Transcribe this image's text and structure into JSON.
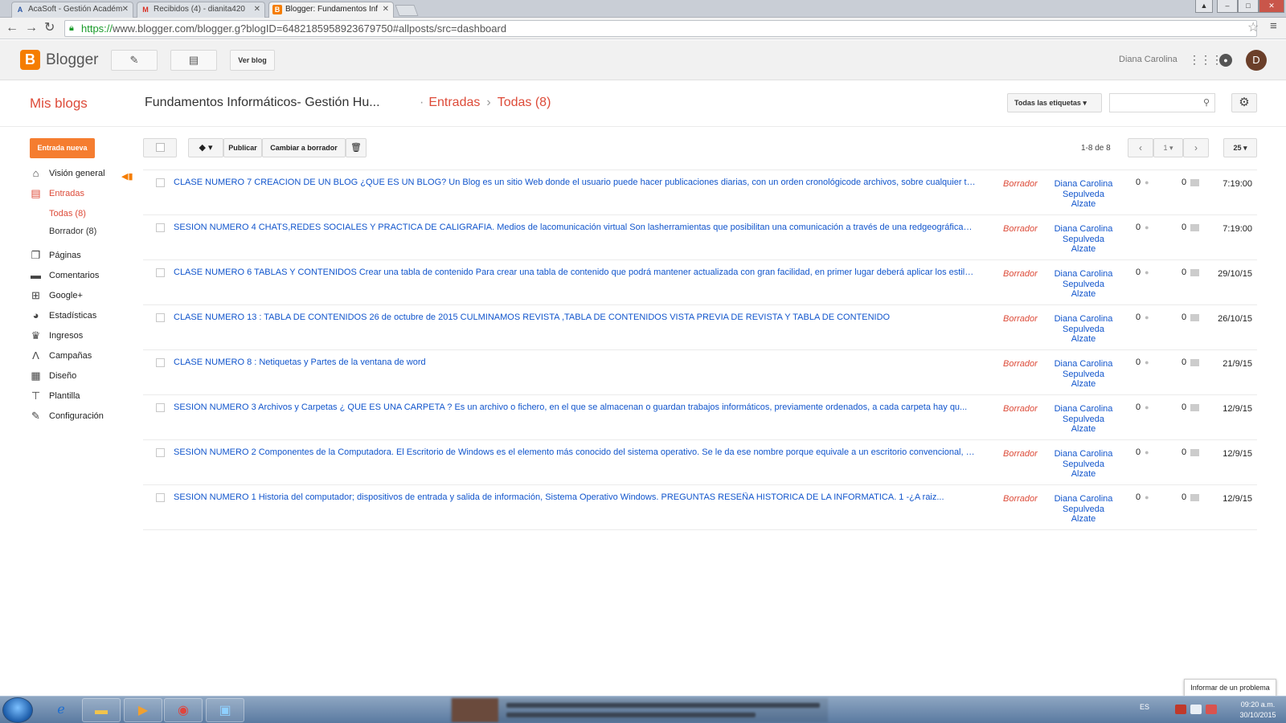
{
  "browser": {
    "tabs": [
      {
        "label": "AcaSoft - Gestión Académ",
        "icon": "acasoft-icon",
        "icon_color": "#2a55a5",
        "active": false
      },
      {
        "label": "Recibidos (4) - dianita420",
        "icon": "gmail-icon",
        "icon_color": "#d93025",
        "active": false
      },
      {
        "label": "Blogger: Fundamentos Inf",
        "icon": "blogger-icon",
        "icon_color": "#f57d00",
        "active": true
      }
    ],
    "url_scheme": "https://",
    "url_rest": "www.blogger.com/blogger.g?blogID=6482185958923679750#allposts/src=dashboard"
  },
  "header": {
    "brand": "Blogger",
    "view_blog_label": "Ver blog",
    "user_name": "Diana Carolina",
    "avatar_letter": "D"
  },
  "titlebar": {
    "my_blogs": "Mis blogs",
    "blog_name": "Fundamentos Informáticos- Gestión Hu...",
    "crumb_section": "Entradas",
    "crumb_filter": "Todas (8)",
    "labels_select": "Todas las etiquetas"
  },
  "sidebar": {
    "new_post_label": "Entrada nueva",
    "overview": "Visión general",
    "posts": "Entradas",
    "posts_all": "Todas (8)",
    "posts_draft": "Borrador (8)",
    "pages": "Páginas",
    "comments": "Comentarios",
    "google_plus": "Google+",
    "stats": "Estadísticas",
    "earnings": "Ingresos",
    "campaigns": "Campañas",
    "layout": "Diseño",
    "template": "Plantilla",
    "settings": "Configuración"
  },
  "toolbar": {
    "publish": "Publicar",
    "revert_draft": "Cambiar a borrador",
    "page_info": "1-8 de 8",
    "page_number": "1",
    "per_page": "25"
  },
  "posts": [
    {
      "title": "CLASE NUMERO 7 CREACION DE UN BLOG ¿QUE ES UN BLOG?   Un Blog es un sitio Web donde el usuario puede hacer publicaciones diarias, con un orden cronológicode archivos, sobre cualquier te...",
      "status": "Borrador",
      "author1": "Diana Carolina",
      "author2": "Sepulveda",
      "author3": "Alzate",
      "comments": "0",
      "views": "0",
      "date": "7:19:00"
    },
    {
      "title": "SESIÓN NUMERO 4 CHATS,REDES SOCIALES Y PRACTICA DE CALIGRAFIA. Medios de lacomunicación virtual Son lasherramientas que posibilitan una comunicación a través de una redgeográficame...",
      "status": "Borrador",
      "author1": "Diana Carolina",
      "author2": "Sepulveda",
      "author3": "Alzate",
      "comments": "0",
      "views": "0",
      "date": "7:19:00"
    },
    {
      "title": "CLASE NUMERO 6 TABLAS Y CONTENIDOS Crear una tabla de contenido Para crear una tabla de contenido que podrá mantener actualizada con gran facilidad, en primer lugar deberá aplicar los estilos d...",
      "status": "Borrador",
      "author1": "Diana Carolina",
      "author2": "Sepulveda",
      "author3": "Alzate",
      "comments": "0",
      "views": "0",
      "date": "29/10/15"
    },
    {
      "title": "CLASE NUMERO 13 :    TABLA DE CONTENIDOS 26 de octubre de 2015 CULMINAMOS REVISTA ,TABLA DE CONTENIDOS VISTA PREVIA DE REVISTA Y TABLA DE CONTENIDO",
      "status": "Borrador",
      "author1": "Diana Carolina",
      "author2": "Sepulveda",
      "author3": "Alzate",
      "comments": "0",
      "views": "0",
      "date": "26/10/15"
    },
    {
      "title": "CLASE NUMERO 8 : Netiquetas y Partes de la ventana de word",
      "status": "Borrador",
      "author1": "Diana Carolina",
      "author2": "Sepulveda",
      "author3": "Alzate",
      "comments": "0",
      "views": "0",
      "date": "21/9/15"
    },
    {
      "title": "SESIÓN NUMERO 3  Archivos y Carpetas    ¿ QUE ES UNA CARPETA ?   Es un archivo o fichero, en el que se almacenan o guardan trabajos informáticos, previamente ordenados, a cada carpeta hay qu...",
      "status": "Borrador",
      "author1": "Diana Carolina",
      "author2": "Sepulveda",
      "author3": "Alzate",
      "comments": "0",
      "views": "0",
      "date": "12/9/15"
    },
    {
      "title": "SESIÓN NUMERO 2   Componentes de la Computadora. El Escritorio de Windows es el elemento más conocido del sistema operativo. Se le da ese nombre porque equivale a un escritorio convencional, co...",
      "status": "Borrador",
      "author1": "Diana Carolina",
      "author2": "Sepulveda",
      "author3": "Alzate",
      "comments": "0",
      "views": "0",
      "date": "12/9/15"
    },
    {
      "title": "SESIÓN NUMERO 1  Historia del computador; dispositivos de entrada y salida de información, Sistema Operativo Windows.              PREGUNTAS RESEÑA HISTORICA DE LA INFORMATICA. 1 -¿A raiz...",
      "status": "Borrador",
      "author1": "Diana Carolina",
      "author2": "Sepulveda",
      "author3": "Alzate",
      "comments": "0",
      "views": "0",
      "date": "12/9/15"
    }
  ],
  "report_problem": "Informar de un problema",
  "taskbar": {
    "language": "ES",
    "time": "09:20 a.m.",
    "date": "30/10/2015"
  },
  "colors": {
    "accent": "#dd4b39",
    "brand": "#f57d00",
    "link": "#1155cc"
  }
}
